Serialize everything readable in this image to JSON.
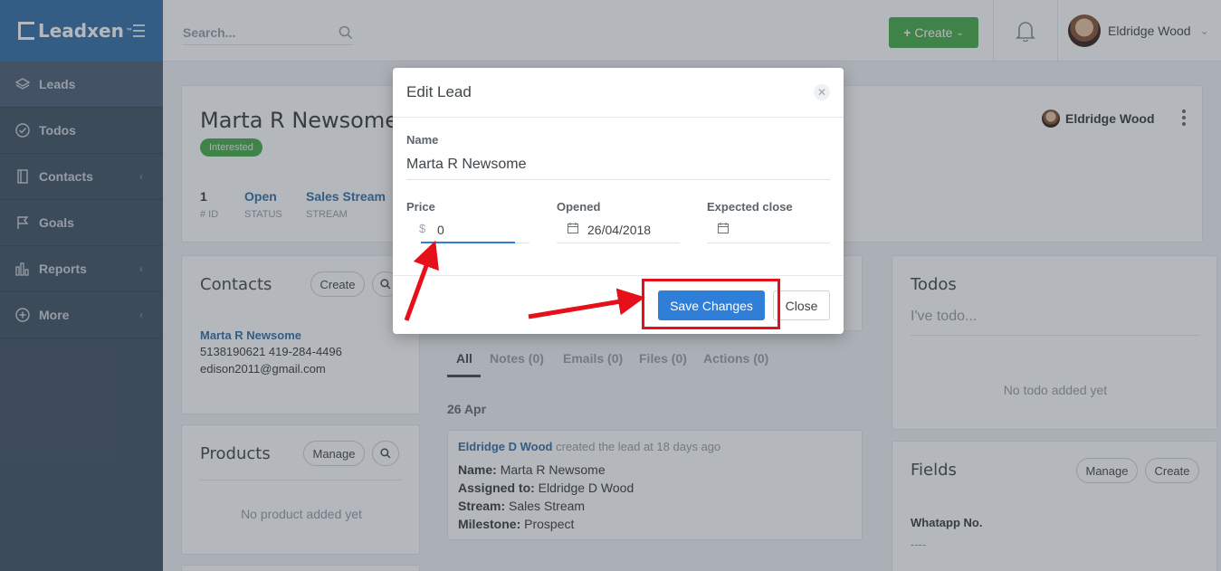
{
  "brand": {
    "name": "Leadxen",
    "tm": "™"
  },
  "sidebar": {
    "items": [
      {
        "label": "Leads",
        "icon": "layers-icon"
      },
      {
        "label": "Todos",
        "icon": "check-circle-icon"
      },
      {
        "label": "Contacts",
        "icon": "address-book-icon"
      },
      {
        "label": "Goals",
        "icon": "flag-icon"
      },
      {
        "label": "Reports",
        "icon": "bar-chart-icon"
      },
      {
        "label": "More",
        "icon": "plus-circle-icon"
      }
    ]
  },
  "header": {
    "search_placeholder": "Search...",
    "create_label": "Create",
    "user_name": "Eldridge Wood"
  },
  "lead": {
    "name": "Marta R Newsome",
    "status_pill": "Interested",
    "owner": "Eldridge Wood",
    "stats": [
      {
        "value": "1",
        "label": "# ID"
      },
      {
        "value": "Open",
        "label": "STATUS"
      },
      {
        "value": "Sales Stream",
        "label": "STREAM"
      }
    ]
  },
  "contacts": {
    "title": "Contacts",
    "create_label": "Create",
    "name": "Marta R Newsome",
    "phones": "5138190621 419-284-4496",
    "email": "edison2011@gmail.com"
  },
  "products": {
    "title": "Products",
    "manage_label": "Manage",
    "empty": "No product added yet"
  },
  "activity": {
    "tabs": [
      "All",
      "Notes (0)",
      "Emails (0)",
      "Files (0)",
      "Actions (0)"
    ],
    "date": "26 Apr",
    "actor": "Eldridge D Wood",
    "action": "created the lead at 18 days ago",
    "rows": [
      {
        "k": "Name:",
        "v": "Marta R Newsome"
      },
      {
        "k": "Assigned to:",
        "v": "Eldridge D Wood"
      },
      {
        "k": "Stream:",
        "v": "Sales Stream"
      },
      {
        "k": "Milestone:",
        "v": "Prospect"
      }
    ]
  },
  "todos": {
    "title": "Todos",
    "placeholder": "I've todo...",
    "empty": "No todo added yet"
  },
  "fields": {
    "title": "Fields",
    "manage_label": "Manage",
    "create_label": "Create",
    "whatsapp_label": "Whatapp No.",
    "whatsapp_value": "----"
  },
  "modal": {
    "title": "Edit Lead",
    "name_label": "Name",
    "name_value": "Marta R Newsome",
    "price_label": "Price",
    "price_prefix": "$",
    "price_value": "0",
    "opened_label": "Opened",
    "opened_value": "26/04/2018",
    "expected_label": "Expected close",
    "expected_value": "",
    "save_label": "Save Changes",
    "close_label": "Close"
  },
  "colors": {
    "sidebar": "#48596b",
    "brand": "#3a76ad",
    "primary_button": "#2f7ed8",
    "create_button": "#4caf50",
    "annotation": "#e5101a"
  }
}
